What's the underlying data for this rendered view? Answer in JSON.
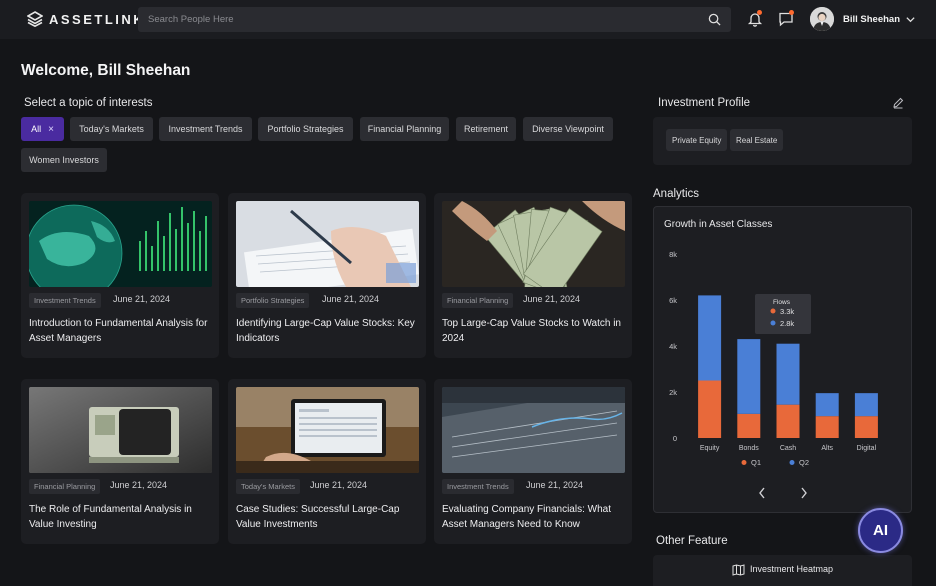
{
  "header": {
    "brand": "ASSETLINK",
    "search_placeholder": "Search People Here",
    "user_name": "Bill Sheehan"
  },
  "welcome": "Welcome, Bill Sheehan",
  "topics": {
    "title": "Select a topic of interests",
    "chips": [
      "All",
      "Today's Markets",
      "Investment Trends",
      "Portfolio Strategies",
      "Financial Planning",
      "Retirement",
      "Diverse Viewpoint",
      "Women Investors"
    ],
    "remove_symbol": "×"
  },
  "cards": [
    {
      "tag": "Investment Trends",
      "date": "June 21, 2024",
      "title": "Introduction to Fundamental Analysis for Asset Managers",
      "image": "globe-image"
    },
    {
      "tag": "Portfolio Strategies",
      "date": "June 21, 2024",
      "title": "Identifying Large-Cap Value Stocks: Key Indicators",
      "image": "writing-image"
    },
    {
      "tag": "Financial Planning",
      "date": "June 21, 2024",
      "title": "Top Large-Cap Value Stocks to Watch in 2024",
      "image": "cash-image"
    },
    {
      "tag": "Financial Planning",
      "date": "June 21, 2024",
      "title": "The Role of Fundamental Analysis in Value Investing",
      "image": "money-clip-image"
    },
    {
      "tag": "Today's Markets",
      "date": "June 21, 2024",
      "title": "Case Studies: Successful Large-Cap Value Investments",
      "image": "laptop-image"
    },
    {
      "tag": "Investment Trends",
      "date": "June 21, 2024",
      "title": "Evaluating Company Financials: What Asset Managers Need to Know",
      "image": "screen-image"
    }
  ],
  "profile": {
    "title": "Investment Profile",
    "chips": [
      "Private Equity",
      "Real Estate"
    ]
  },
  "analytics": {
    "title": "Analytics"
  },
  "chart_data": {
    "type": "bar",
    "stacked": true,
    "title": "Growth in Asset Classes",
    "categories": [
      "Equity",
      "Bonds",
      "Cash",
      "Alts",
      "Digital"
    ],
    "series": [
      {
        "name": "Q1",
        "color": "#e8693a",
        "values": [
          2500,
          1050,
          1450,
          950,
          950
        ]
      },
      {
        "name": "Q2",
        "color": "#4a7fd6",
        "values": [
          3700,
          3250,
          2650,
          1000,
          1000
        ]
      }
    ],
    "yticks": [
      "0",
      "2k",
      "4k",
      "6k",
      "8k"
    ],
    "ylim": [
      0,
      8000
    ],
    "legend": "bottom",
    "tooltip": {
      "title": "Flows",
      "items": [
        {
          "color": "#e8693a",
          "value": "3.3k"
        },
        {
          "color": "#4a7fd6",
          "value": "2.8k"
        }
      ]
    }
  },
  "other_feature": {
    "title": "Other Feature",
    "heatmap_label": "Investment Heatmap"
  },
  "ai_label": "AI"
}
